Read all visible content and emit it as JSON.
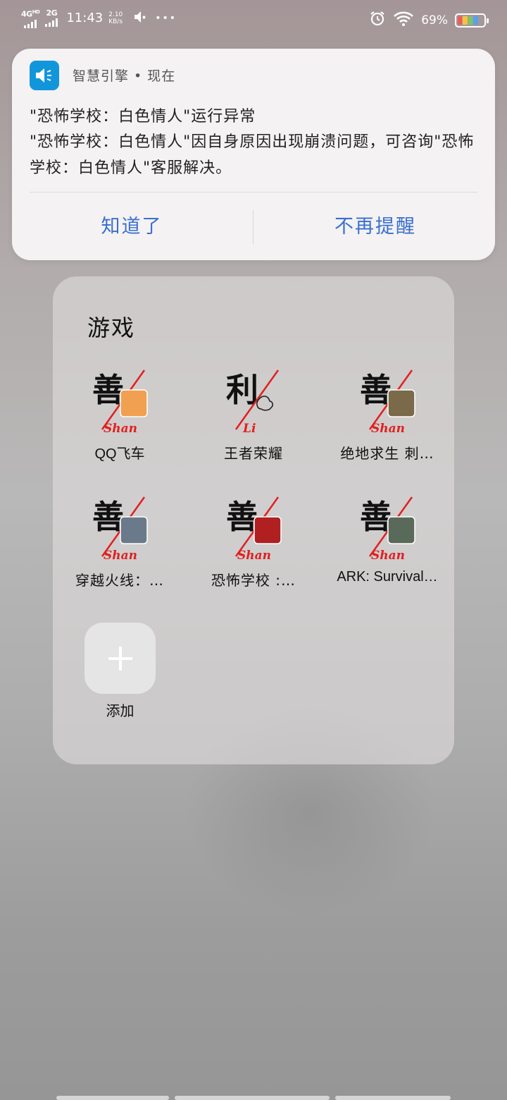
{
  "status_bar": {
    "sim1": "4G",
    "sim1_hd": "HD",
    "sim2": "2G",
    "time": "11:43",
    "speed_value": "2.10",
    "speed_unit": "KB/s",
    "dots": "•••",
    "battery_percent": "69%"
  },
  "notification": {
    "app_name": "智慧引擎 • 现在",
    "title": "\"恐怖学校：白色情人\"运行异常",
    "body": "\"恐怖学校：白色情人\"因自身原因出现崩溃问题，可咨询\"恐怖学校：白色情人\"客服解决。",
    "action_ok": "知道了",
    "action_dismiss": "不再提醒"
  },
  "folder": {
    "title": "游戏",
    "apps": [
      {
        "label": "QQ飞车",
        "badge": "善",
        "sub": "Shan",
        "thumb_color": "#f0a050"
      },
      {
        "label": "王者荣耀",
        "badge": "利",
        "sub": "Li",
        "thumb_color": ""
      },
      {
        "label": "绝地求生 刺…",
        "badge": "善",
        "sub": "Shan",
        "thumb_color": "#7a6a4a"
      },
      {
        "label": "穿越火线：…",
        "badge": "善",
        "sub": "Shan",
        "thumb_color": "#6a7a8a"
      },
      {
        "label": "恐怖学校 :…",
        "badge": "善",
        "sub": "Shan",
        "thumb_color": "#b02020"
      },
      {
        "label": "ARK: Survival…",
        "badge": "善",
        "sub": "Shan",
        "thumb_color": "#5a6a5a"
      }
    ],
    "add_label": "添加"
  }
}
